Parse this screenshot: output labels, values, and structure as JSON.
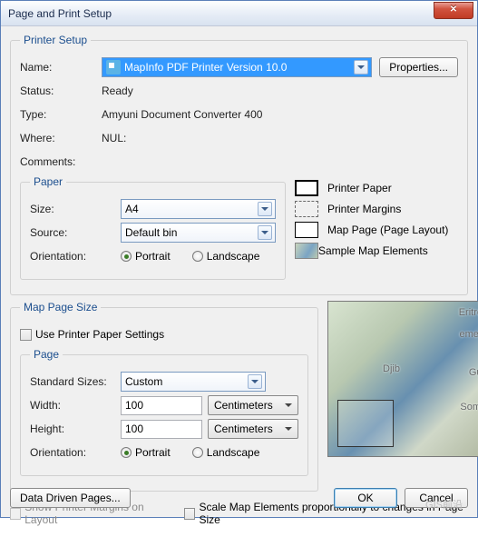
{
  "window": {
    "title": "Page and Print Setup"
  },
  "printerSetup": {
    "legend": "Printer Setup",
    "nameLabel": "Name:",
    "nameValue": "MapInfo PDF Printer Version 10.0",
    "propertiesBtn": "Properties...",
    "statusLabel": "Status:",
    "statusValue": "Ready",
    "typeLabel": "Type:",
    "typeValue": "Amyuni Document Converter 400",
    "whereLabel": "Where:",
    "whereValue": "NUL:",
    "commentsLabel": "Comments:",
    "commentsValue": ""
  },
  "paper": {
    "legend": "Paper",
    "sizeLabel": "Size:",
    "sizeValue": "A4",
    "sourceLabel": "Source:",
    "sourceValue": "Default bin",
    "orientLabel": "Orientation:",
    "portrait": "Portrait",
    "landscape": "Landscape"
  },
  "legendPanel": {
    "printerPaper": "Printer Paper",
    "printerMargins": "Printer Margins",
    "mapPage": "Map Page (Page Layout)",
    "sampleElements": "Sample Map Elements"
  },
  "mapPage": {
    "legend": "Map Page Size",
    "usePrinter": "Use Printer Paper Settings",
    "pageLegend": "Page",
    "stdSizesLabel": "Standard Sizes:",
    "stdSizesValue": "Custom",
    "widthLabel": "Width:",
    "widthValue": "100",
    "widthUnit": "Centimeters",
    "heightLabel": "Height:",
    "heightValue": "100",
    "heightUnit": "Centimeters",
    "orientLabel": "Orientation:",
    "portrait": "Portrait",
    "landscape": "Landscape"
  },
  "options": {
    "showMargins": "Show Printer Margins on Layout",
    "scaleElements": "Scale Map Elements proportionally to changes in Page Size"
  },
  "buttons": {
    "dataDriven": "Data Driven Pages...",
    "ok": "OK",
    "cancel": "Cancel"
  },
  "watermark": "GIS前沿"
}
